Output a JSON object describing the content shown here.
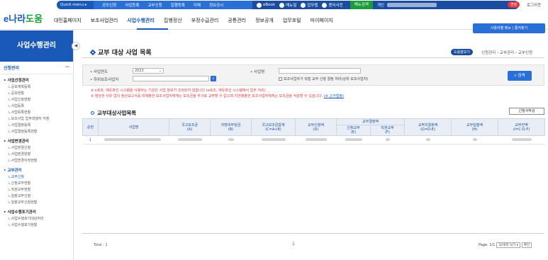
{
  "topbar": {
    "quickmenu_label": "Quick menu ▸",
    "links": [
      "공모신청",
      "사업등록",
      "교부신청",
      "집행등록",
      "이체",
      "정보공시"
    ],
    "ebook": "eBook",
    "manual": "매뉴얼",
    "work": "업무맵",
    "dictionary": "용어사전",
    "menu_search": "메뉴검색",
    "user_prefix": "개인",
    "login_badge": "연장",
    "logout": "로그아웃"
  },
  "header": {
    "logo_main": "e나라",
    "logo_accent": "도움",
    "nav": [
      "대민홈페이지",
      "보조사업관리",
      "사업수행관리",
      "집행정산",
      "부정수급관리",
      "공통관리",
      "정보공개",
      "업무포털",
      "마이페이지"
    ],
    "active_nav_index": 2,
    "menu_toggle": "사용자별 메뉴 | 즐겨찾기"
  },
  "sidebar": {
    "title": "사업수행관리",
    "collapse_icon": "◀",
    "section": "신청관리",
    "groups": [
      {
        "title": "사업선정관리",
        "items": [
          "공모계획등록",
          "공모현황",
          "사업신청현황",
          "사업등록",
          "사업목록현황",
          "보조사업 업무대행자 지정",
          "사업결정등록",
          "사업결정등록현황"
        ]
      },
      {
        "title": "사업변경관리",
        "items": [
          "사업변경신청",
          "사업변경현황",
          "사업변경이력현황"
        ]
      },
      {
        "title": "교부관리",
        "items": [
          "교부신청",
          "신청교부현황",
          "직권교부현황",
          "일괄교부신청",
          "일괄교부신청현황"
        ]
      },
      {
        "title": "사업수행포기관리",
        "items": [
          "사업수행포기대상처리",
          "사업수행포기현황"
        ]
      }
    ],
    "active_group": "교부관리",
    "active_item": "교부신청"
  },
  "page": {
    "title": "교부 대상 사업 목록",
    "help": "도움말보기",
    "breadcrumb": "신청관리 › 교부관리 › 교부신청"
  },
  "search": {
    "year_label": "사업연도",
    "year_value": "2023",
    "subsidy_label": "하위보조사업자",
    "name_label": "사업명",
    "checkbox_label": "보조사업자가 직접 교부 신청 결정 처리(상위 보조사업자)",
    "search_button": "검색",
    "search_icon": "search-icon"
  },
  "notes": {
    "line1": "※ e호조, 에듀파인 시스템을 사용하는 기관은 사업 정보가 조회되지 않습니다 (e호조, 에듀파인 시스템에서 업무 처리)",
    "line2": "※ 정당한 사유 없이 정산보고서를 미제출한 보조사업자에게는 보조금을 추가로 교부할 수 없으며 지연제출한 보조사업자에게는 보조금을 삭감할 수 있습니다.",
    "link": "(※ 근거법령)"
  },
  "list": {
    "title": "교부대상사업목록",
    "request_button": "신청서작성",
    "headers": {
      "no": "순번",
      "name": "사업명",
      "national": "국고보조금\n(A)",
      "local": "지방비부담금\n(B)",
      "total": "국고보조금합계\n(C=A+B)",
      "applied": "교부신청액\n(D)",
      "decision": "교부결정액",
      "apply_decision": "신청교부\n(E)",
      "direct_decision": "직권교부\n(F)",
      "undecided": "교부미결정액\n(G=D-E)",
      "paid": "교부집행액\n(H)",
      "balance": "교부잔액\n(I=C-D-F)"
    },
    "rows": [
      {
        "no": "1"
      }
    ],
    "total_label": "Total : 1",
    "current_page": "1",
    "page_info": "Page: 1/1",
    "page_size": "10개씩 보기 ▾",
    "confirm": "확인"
  }
}
